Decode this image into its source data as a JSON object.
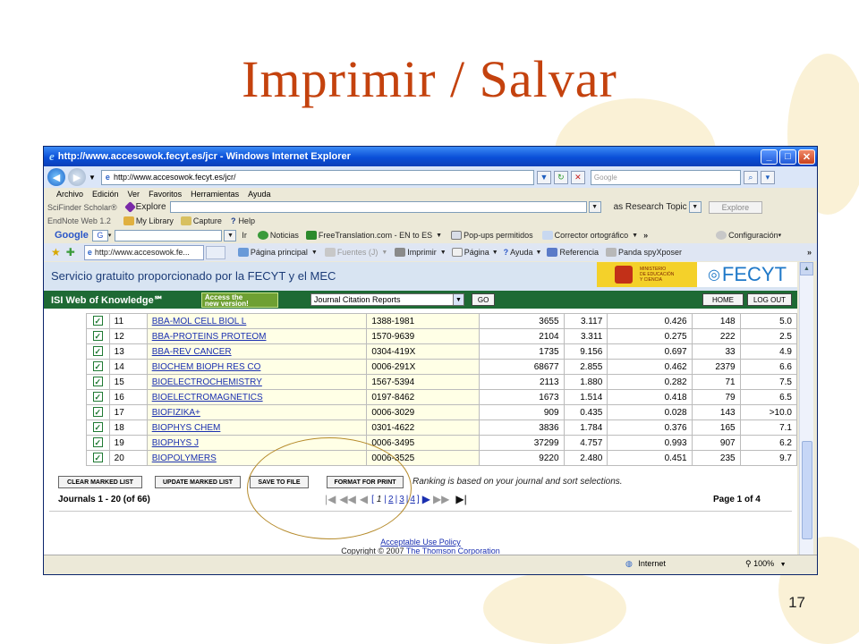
{
  "slide": {
    "title": "Imprimir / Salvar",
    "page_number": "17"
  },
  "browser": {
    "window_title": "http://www.accesowok.fecyt.es/jcr - Windows Internet Explorer",
    "address": "http://www.accesowok.fecyt.es/jcr/",
    "search_placeholder": "Google",
    "menu": [
      "Archivo",
      "Edición",
      "Ver",
      "Favoritos",
      "Herramientas",
      "Ayuda"
    ],
    "scifinder": {
      "label": "SciFinder Scholar®",
      "explore": "Explore",
      "topic": "as Research Topic",
      "explore_btn": "Explore"
    },
    "endnote": {
      "label": "EndNote Web 1.2",
      "library": "My Library",
      "capture": "Capture",
      "help": "Help"
    },
    "google_bar": {
      "google": "Google",
      "g": "G",
      "ir": "Ir",
      "noticias": "Noticias",
      "freetranslation": "FreeTranslation.com - EN to ES",
      "popups": "Pop-ups permitidos",
      "corrector": "Corrector ortográfico",
      "more": "»",
      "config": "Configuración"
    },
    "tab_label": "http://www.accesowok.fe...",
    "cmd_bar": {
      "home": "Página principal",
      "feeds": "Fuentes (J)",
      "print": "Imprimir",
      "page": "Página",
      "help": "Ayuda",
      "ref": "Referencia",
      "panda": "Panda spyXposer",
      "more": "»"
    },
    "status": {
      "zone": "Internet",
      "zoom": "100%"
    }
  },
  "page": {
    "banner": "Servicio gratuito proporcionado por la FECYT y el MEC",
    "mec_logo": [
      "MINISTERIO",
      "DE EDUCACIÓN",
      "Y CIENCIA"
    ],
    "fecyt_logo": "FECYT",
    "isi_title": "ISI Web of Knowledge℠",
    "access_btn": [
      "Access the",
      "new version!"
    ],
    "jcr_select": "Journal Citation Reports",
    "go": "GO",
    "home": "HOME",
    "logout": "LOG OUT",
    "rows": [
      [
        "11",
        "BBA-MOL CELL BIOL L",
        "1388-1981",
        "3655",
        "3.117",
        "0.426",
        "148",
        "5.0"
      ],
      [
        "12",
        "BBA-PROTEINS PROTEOM",
        "1570-9639",
        "2104",
        "3.311",
        "0.275",
        "222",
        "2.5"
      ],
      [
        "13",
        "BBA-REV CANCER",
        "0304-419X",
        "1735",
        "9.156",
        "0.697",
        "33",
        "4.9"
      ],
      [
        "14",
        "BIOCHEM BIOPH RES CO",
        "0006-291X",
        "68677",
        "2.855",
        "0.462",
        "2379",
        "6.6"
      ],
      [
        "15",
        "BIOELECTROCHEMISTRY",
        "1567-5394",
        "2113",
        "1.880",
        "0.282",
        "71",
        "7.5"
      ],
      [
        "16",
        "BIOELECTROMAGNETICS",
        "0197-8462",
        "1673",
        "1.514",
        "0.418",
        "79",
        "6.5"
      ],
      [
        "17",
        "BIOFIZIKA+",
        "0006-3029",
        "909",
        "0.435",
        "0.028",
        "143",
        ">10.0"
      ],
      [
        "18",
        "BIOPHYS CHEM",
        "0301-4622",
        "3836",
        "1.784",
        "0.376",
        "165",
        "7.1"
      ],
      [
        "19",
        "BIOPHYS J",
        "0006-3495",
        "37299",
        "4.757",
        "0.993",
        "907",
        "6.2"
      ],
      [
        "20",
        "BIOPOLYMERS",
        "0006-3525",
        "9220",
        "2.480",
        "0.451",
        "235",
        "9.7"
      ]
    ],
    "buttons": {
      "clear": "CLEAR MARKED LIST",
      "update": "UPDATE MARKED LIST",
      "save": "SAVE TO FILE",
      "print": "FORMAT FOR PRINT"
    },
    "ranking_note": "Ranking is based on your journal and sort selections.",
    "journals_count": "Journals 1 - 20 (of 66)",
    "pager": {
      "pages": [
        "1",
        "2",
        "3",
        "4"
      ],
      "page_of": "Page 1 of 4"
    },
    "footer_link": "Acceptable Use Policy",
    "copyright": "Copyright © 2007",
    "copyright_link": "The Thomson Corporation"
  },
  "colors": {
    "title": "#c4420e",
    "isi_green": "#1e6a34",
    "banner_bg": "#d8e4f2",
    "link": "#1a2fb0",
    "circle": "#b58a2a"
  }
}
